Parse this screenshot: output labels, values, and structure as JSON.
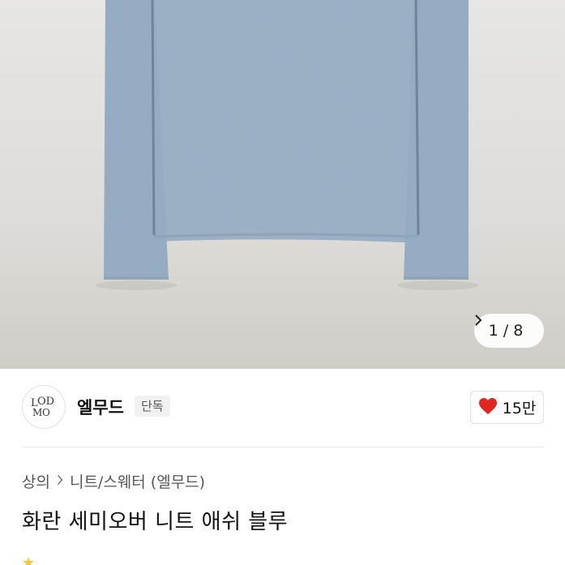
{
  "gallery": {
    "current": 1,
    "total": 8,
    "counter_text": "1 / 8",
    "next_icon": "chevron-right-icon",
    "sweater_color": "#9db3c9",
    "background_color": "#e2e1dd"
  },
  "seller": {
    "logo_text": "LM\nOD",
    "name": "엘무드",
    "badge": "단독"
  },
  "like": {
    "icon": "heart-icon",
    "count": "15만",
    "heart_color": "#e0261f"
  },
  "breadcrumb": {
    "category": "상의",
    "subcategory": "니트/스웨터 (엘무드)"
  },
  "product": {
    "title": "화란 세미오버 니트 애쉬 블루"
  }
}
